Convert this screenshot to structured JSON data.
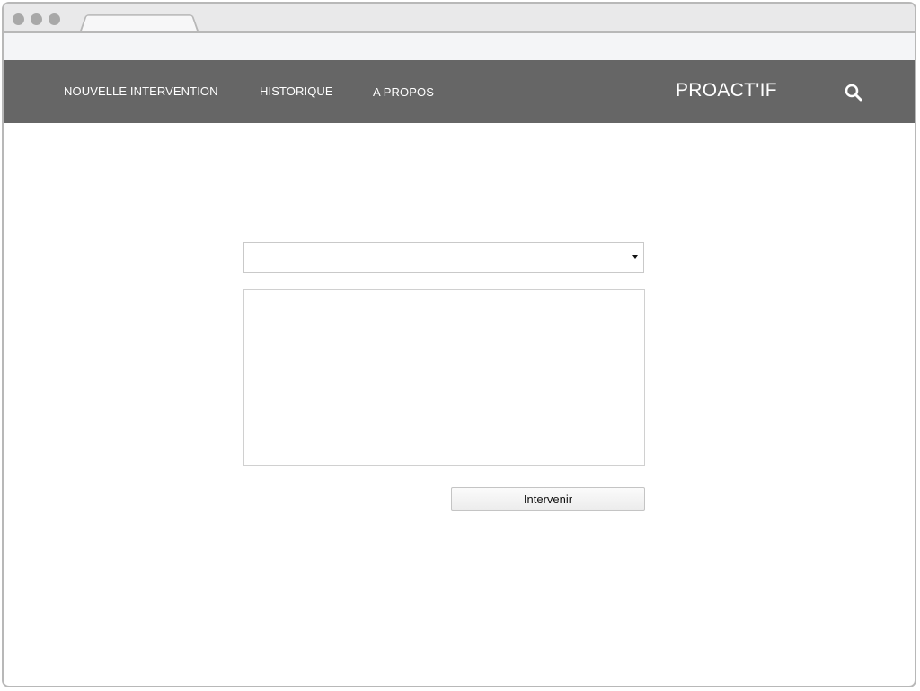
{
  "window": {
    "tab_title": "",
    "address": ""
  },
  "nav": {
    "items": [
      {
        "label": "NOUVELLE INTERVENTION"
      },
      {
        "label": "HISTORIQUE"
      },
      {
        "label": "A PROPOS"
      }
    ],
    "brand": "PROACT'IF",
    "search_icon": "search-icon"
  },
  "form": {
    "select": {
      "value": "",
      "icon": "caret-down-icon"
    },
    "textarea": {
      "value": "",
      "placeholder": ""
    },
    "submit_label": "Intervenir"
  },
  "colors": {
    "navbar_bg": "#666666",
    "nav_text": "#ffffff",
    "page_bg": "#ffffff"
  }
}
